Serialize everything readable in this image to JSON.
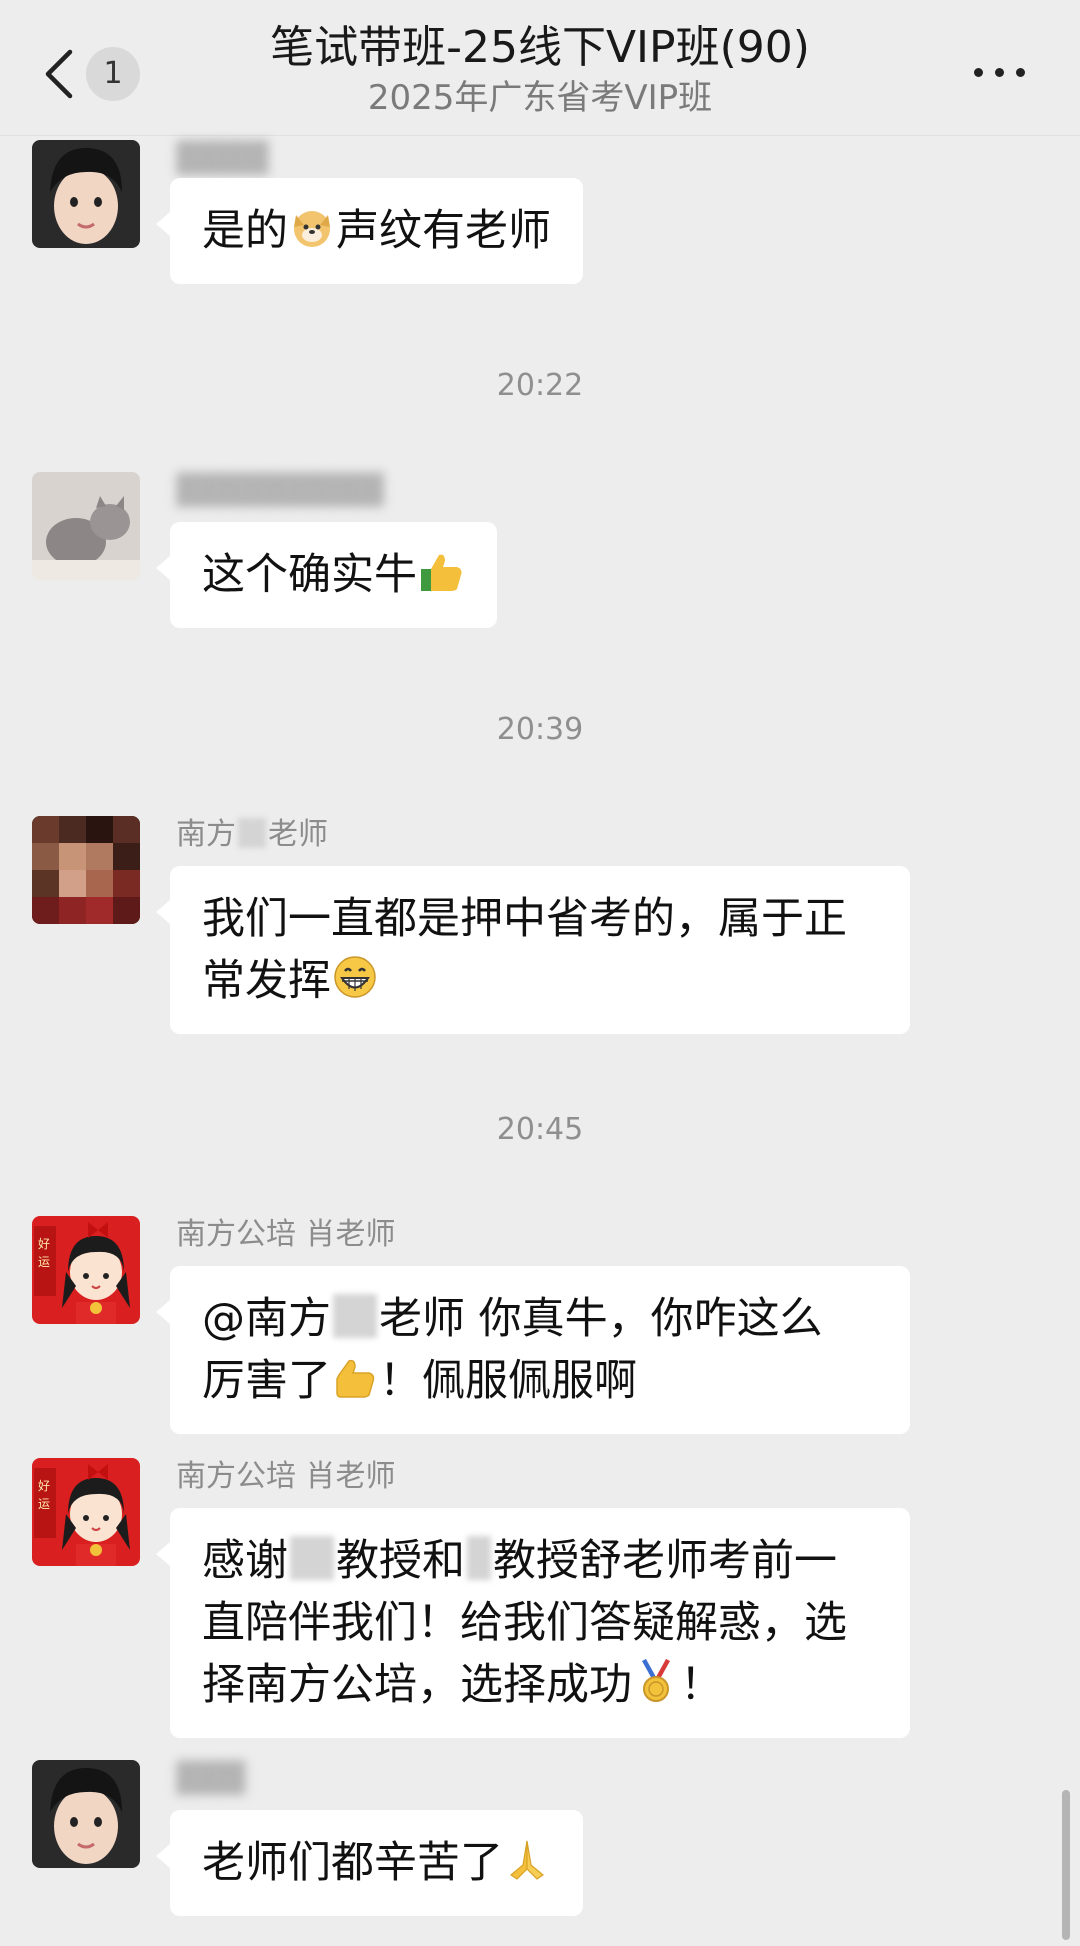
{
  "header": {
    "back_icon": "chevron-left-icon",
    "unread_count": "1",
    "title": "笔试带班-25线下VIP班(90)",
    "subtitle": "2025年广东省考VIP班",
    "more_icon": "more-dots-icon"
  },
  "messages": [
    {
      "sender": "",
      "avatar": "child-photo",
      "text_before": "是的",
      "emoji": "doge-emoji",
      "text_after": "声纹有老师"
    },
    {
      "time": "20:22"
    },
    {
      "sender": "",
      "avatar": "cat-photo",
      "text_before": "这个确实牛",
      "emoji": "thumbs-up-emoji"
    },
    {
      "time": "20:39"
    },
    {
      "sender_before": "南方",
      "sender_after": "老师",
      "avatar": "teacher-photo-blurred",
      "line1": "我们一直都是押中省考的，属于正",
      "line2_before": "常发挥",
      "emoji": "grin-emoji"
    },
    {
      "time": "20:45"
    },
    {
      "sender": "南方公培 肖老师",
      "avatar": "cartoon-girl-red",
      "line1_before": "@南方",
      "line1_after": "老师  你真牛，你咋这么",
      "line2_before": "厉害了",
      "emoji": "thumbs-up-emoji",
      "line2_after": "！佩服佩服啊"
    },
    {
      "sender": "南方公培 肖老师",
      "avatar": "cartoon-girl-red",
      "line1_a": "感谢",
      "line1_b": "教授和",
      "line1_c": "教授舒老师考前一",
      "line2": "直陪伴我们！给我们答疑解惑，选",
      "line3_before": "择南方公培，选择成功",
      "emoji": "medal-emoji",
      "line3_after": "！"
    },
    {
      "sender": "",
      "avatar": "child-photo",
      "text_before": "老师们都辛苦了",
      "emoji": "praying-hands-emoji"
    }
  ],
  "colors": {
    "background": "#ededed",
    "bubble": "#ffffff",
    "text": "#111111",
    "meta": "#8f8f8f"
  }
}
